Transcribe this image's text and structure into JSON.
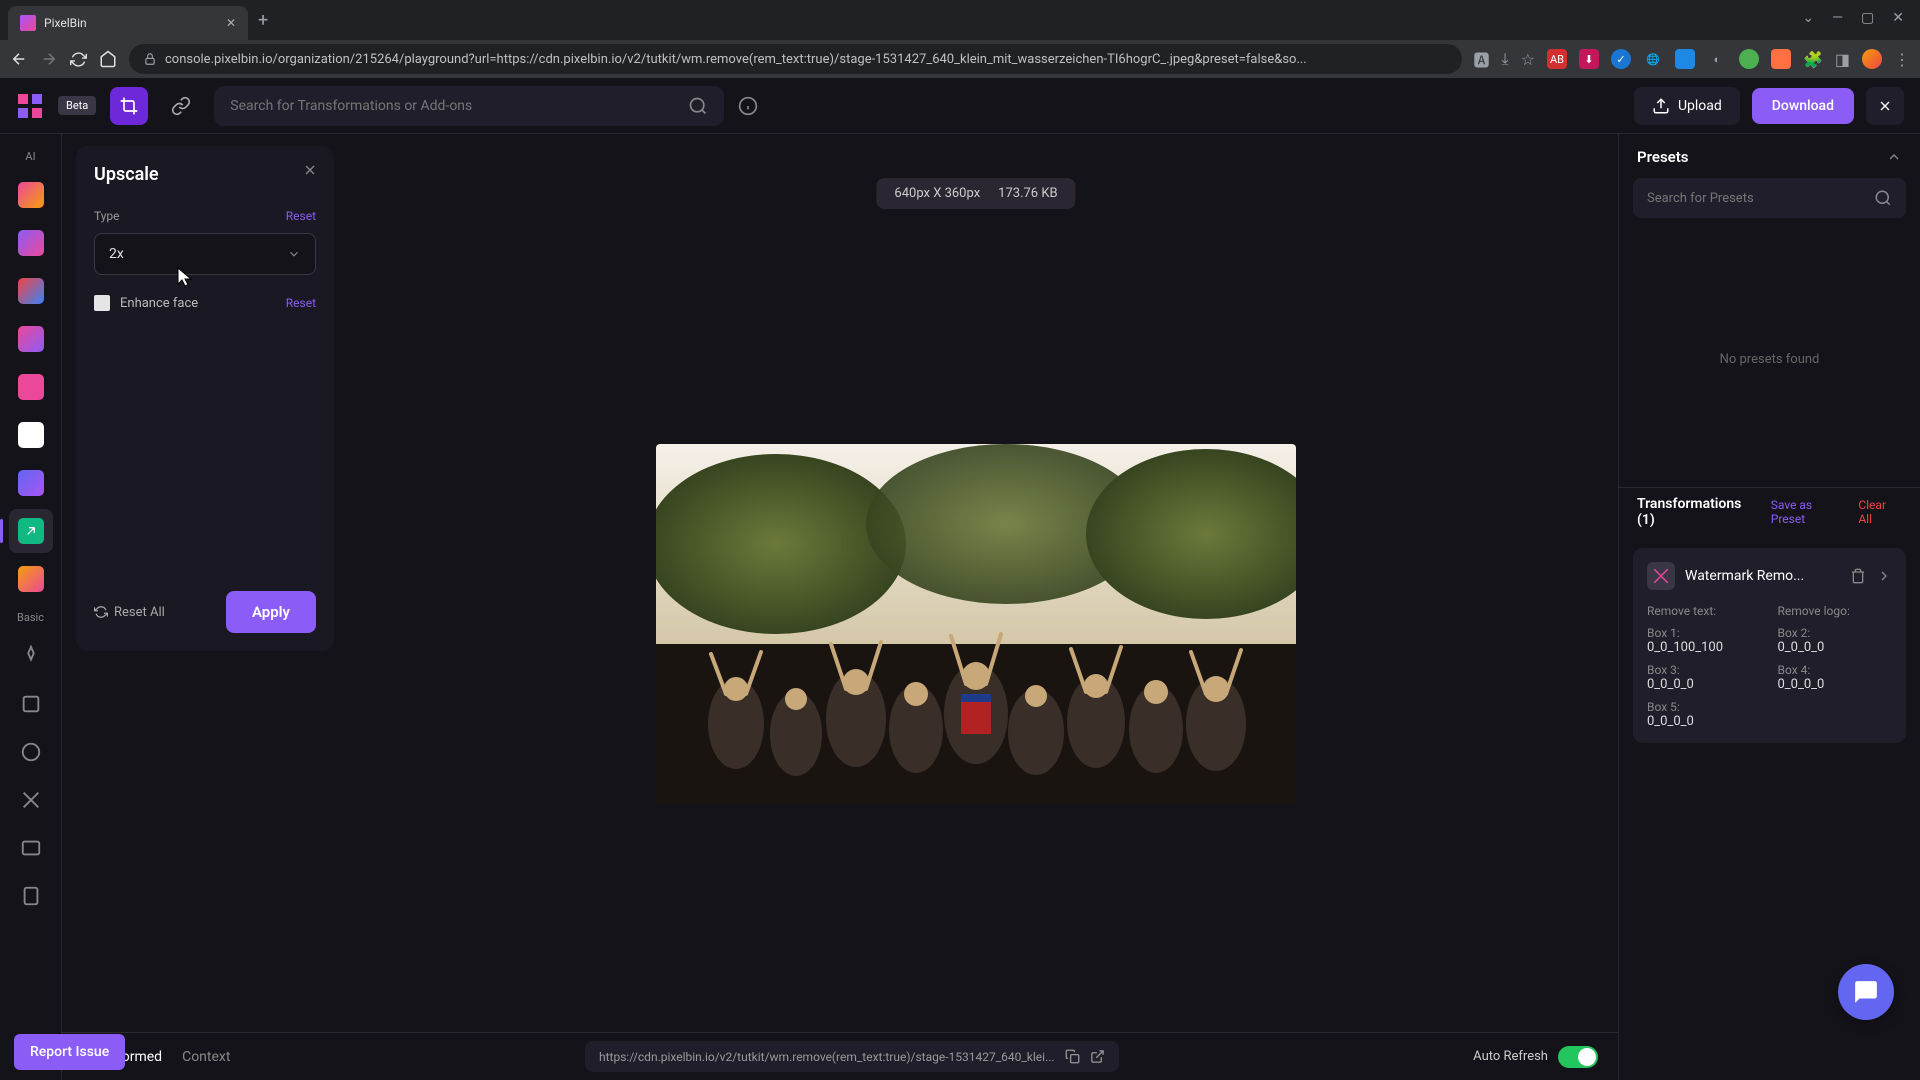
{
  "browser": {
    "tab_title": "PixelBin",
    "url": "console.pixelbin.io/organization/215264/playground?url=https://cdn.pixelbin.io/v2/tutkit/wm.remove(rem_text:true)/stage-1531427_640_klein_mit_wasserzeichen-TI6hogrC_.jpeg&preset=false&so..."
  },
  "header": {
    "beta": "Beta",
    "search_placeholder": "Search for Transformations or Add-ons",
    "upload": "Upload",
    "download": "Download"
  },
  "rail": {
    "ai": "AI",
    "basic": "Basic"
  },
  "panel": {
    "title": "Upscale",
    "type_label": "Type",
    "reset": "Reset",
    "type_value": "2x",
    "enhance_face": "Enhance face",
    "reset_all": "Reset All",
    "apply": "Apply"
  },
  "canvas": {
    "dimensions": "640px X 360px",
    "filesize": "173.76 KB"
  },
  "bottom": {
    "transformed_tab": "Transformed",
    "context_tab": "Context",
    "url": "https://cdn.pixelbin.io/v2/tutkit/wm.remove(rem_text:true)/stage-1531427_640_klei...",
    "auto_refresh": "Auto Refresh"
  },
  "right": {
    "presets_title": "Presets",
    "preset_search_placeholder": "Search for Presets",
    "no_presets": "No presets found",
    "transforms_title": "Transformations (1)",
    "save_preset": "Save as Preset",
    "clear_all": "Clear All",
    "transform": {
      "name": "Watermark Remo...",
      "remove_text_label": "Remove text:",
      "remove_logo_label": "Remove logo:",
      "box1_label": "Box 1:",
      "box1_value": "0_0_100_100",
      "box2_label": "Box 2:",
      "box2_value": "0_0_0_0",
      "box3_label": "Box 3:",
      "box3_value": "0_0_0_0",
      "box4_label": "Box 4:",
      "box4_value": "0_0_0_0",
      "box5_label": "Box 5:",
      "box5_value": "0_0_0_0"
    }
  },
  "report_issue": "Report Issue"
}
